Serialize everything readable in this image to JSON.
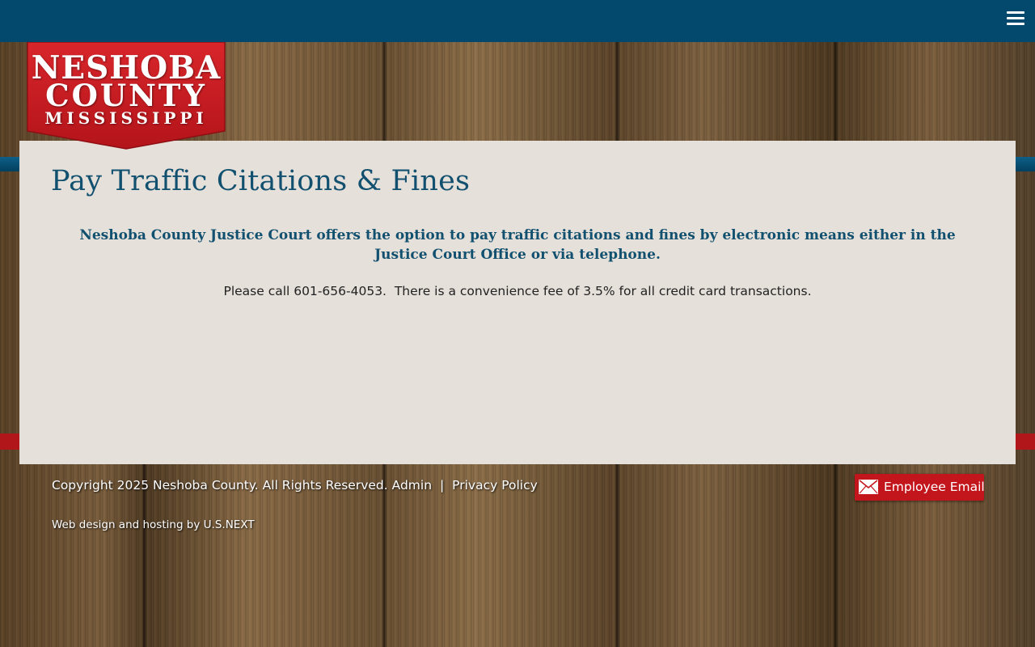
{
  "header": {
    "menu_icon": "hamburger-menu-icon",
    "logo": {
      "line1": "NESHOBA",
      "line2": "COUNTY",
      "line3": "MISSISSIPPI"
    }
  },
  "main": {
    "title": "Pay Traffic Citations & Fines",
    "lead": "Neshoba County Justice Court offers the option to pay traffic citations and fines by electronic means either in the Justice Court Office or via telephone.",
    "body": "Please call 601-656-4053.  There is a convenience fee of 3.5% for all credit card transactions."
  },
  "footer": {
    "copyright": "Copyright 2025 Neshoba County. All Rights Reserved.",
    "admin_link": "Admin",
    "separator": "|",
    "privacy_link": "Privacy Policy",
    "credit_prefix": "Web design and hosting by",
    "credit_link": "U.S.NEXT",
    "email_button": "Employee Email",
    "email_icon": "envelope-icon"
  },
  "colors": {
    "topbar": "#03496d",
    "title": "#12506f",
    "content_bg": "#e6e0da",
    "accent_red": "#c3161c"
  }
}
